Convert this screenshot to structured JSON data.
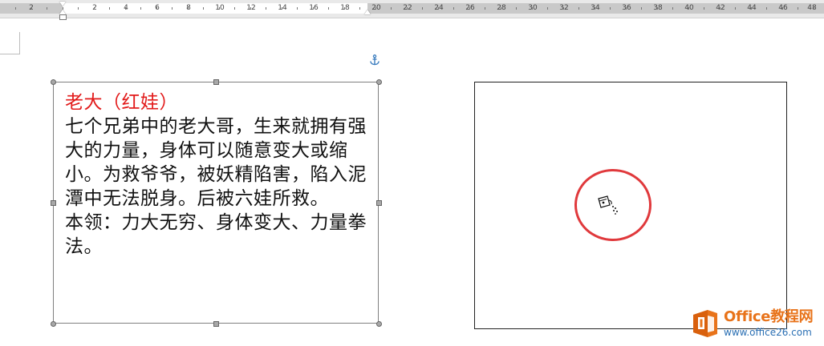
{
  "ruler": {
    "labels": [
      "2",
      "2",
      "4",
      "6",
      "8",
      "10",
      "12",
      "14",
      "16",
      "18",
      "20",
      "22",
      "24",
      "26",
      "28",
      "30",
      "32",
      "34",
      "36",
      "38",
      "40",
      "42",
      "44",
      "46",
      "48"
    ]
  },
  "textbox": {
    "title": "老大（红娃）",
    "body": "七个兄弟中的老大哥，生来就拥有强大的力量，身体可以随意变大或缩小。为救爷爷，被妖精陷害，陷入泥潭中无法脱身。后被六娃所救。",
    "skill": "本领：力大无穷、身体变大、力量拳法。",
    "title_color": "#e21b1b"
  },
  "icons": {
    "anchor": "anchor-icon",
    "cursor": "hand-grab-cursor-icon"
  },
  "highlight": {
    "color": "#e0393c"
  },
  "watermark": {
    "brand": "Office教程网",
    "url": "www.office26.com",
    "brand_color": "#e8731a",
    "url_color": "#2a6fb3"
  }
}
